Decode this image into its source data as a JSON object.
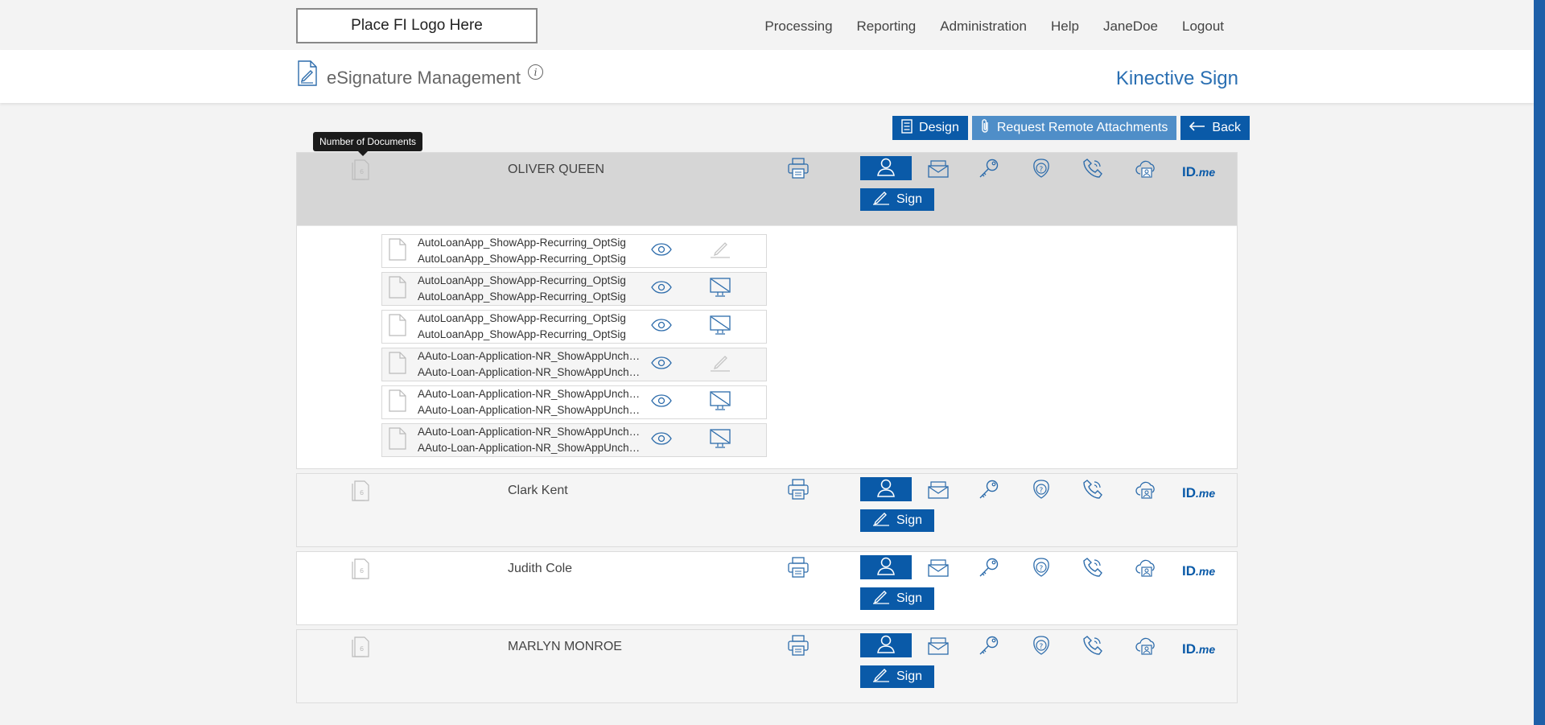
{
  "header": {
    "logo_text": "Place FI Logo Here",
    "nav": [
      "Processing",
      "Reporting",
      "Administration",
      "Help",
      "JaneDoe",
      "Logout"
    ],
    "app_title": "eSignature Management",
    "info_glyph": "i",
    "brand": "Kinective Sign"
  },
  "actions": {
    "design": "Design",
    "request_remote": "Request Remote Attachments",
    "back": "Back"
  },
  "tooltip": "Number of Documents",
  "signers": [
    {
      "name": "OLIVER QUEEN",
      "doc_count": "6",
      "sign_label": "Sign",
      "idme_brand": "ID",
      "idme_suffix": ".me",
      "expanded": true,
      "documents": [
        {
          "line1": "AutoLoanApp_ShowApp-Recurring_OptSig",
          "line2": "AutoLoanApp_ShowApp-Recurring_OptSig",
          "action_icon": "pen-icon"
        },
        {
          "line1": "AutoLoanApp_ShowApp-Recurring_OptSig",
          "line2": "AutoLoanApp_ShowApp-Recurring_OptSig",
          "action_icon": "monitor-icon"
        },
        {
          "line1": "AutoLoanApp_ShowApp-Recurring_OptSig",
          "line2": "AutoLoanApp_ShowApp-Recurring_OptSig",
          "action_icon": "monitor-icon"
        },
        {
          "line1": "AAuto-Loan-Application-NR_ShowAppUnchecked",
          "line2": "AAuto-Loan-Application-NR_ShowAppUnchecked",
          "action_icon": "pen-icon"
        },
        {
          "line1": "AAuto-Loan-Application-NR_ShowAppUnchecked",
          "line2": "AAuto-Loan-Application-NR_ShowAppUnchecked",
          "action_icon": "monitor-icon"
        },
        {
          "line1": "AAuto-Loan-Application-NR_ShowAppUnchecked",
          "line2": "AAuto-Loan-Application-NR_ShowAppUnchecked",
          "action_icon": "monitor-icon"
        }
      ]
    },
    {
      "name": "Clark Kent",
      "doc_count": "6",
      "sign_label": "Sign",
      "idme_brand": "ID",
      "idme_suffix": ".me",
      "expanded": false
    },
    {
      "name": "Judith Cole",
      "doc_count": "6",
      "sign_label": "Sign",
      "idme_brand": "ID",
      "idme_suffix": ".me",
      "expanded": false
    },
    {
      "name": "MARLYN MONROE",
      "doc_count": "6",
      "sign_label": "Sign",
      "idme_brand": "ID",
      "idme_suffix": ".me",
      "expanded": false
    }
  ],
  "colors": {
    "primary": "#0a5aa8",
    "secondary_button": "#4f8ec8",
    "brand_text": "#2a6fb2",
    "icon_stroke": "#2d6cab",
    "active_row": "#d6d6d6",
    "alt_row": "#f5f5f5"
  },
  "icons": [
    "document-sign-icon",
    "info-icon",
    "list-icon",
    "paperclip-icon",
    "arrow-left-icon",
    "document-count-icon",
    "printer-icon",
    "person-icon",
    "email-icon",
    "key-icon",
    "security-question-icon",
    "phone-icon",
    "cloud-id-icon",
    "idme-icon",
    "pen-icon",
    "file-icon",
    "eye-icon",
    "monitor-icon"
  ]
}
